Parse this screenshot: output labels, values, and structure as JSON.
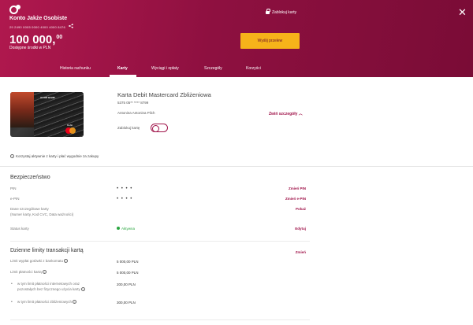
{
  "header": {
    "account_name": "Konto Jakże Osobiste",
    "account_number": "29 2490 0005 0000 4000 4000 8476",
    "balance_main": "100 000,",
    "balance_fraction": "00",
    "balance_label": "Dostępne środki w PLN",
    "block_card": "Zablokuj karty",
    "send_transfer": "Wyślij przelew"
  },
  "tabs": [
    {
      "label": "Historia rachunku"
    },
    {
      "label": "Karty"
    },
    {
      "label": "Wyciągi i opłaty"
    },
    {
      "label": "Szczegóły"
    },
    {
      "label": "Korzyści"
    }
  ],
  "card": {
    "bank_name": "ALIOR BANK",
    "debit_label": "Debit",
    "title": "Karta Debit Mastercard Zbliżeniowa",
    "number": "5375 05** **** 8799",
    "holder": "Antonina Antonina Pilch",
    "collapse_label": "Zwiń szczegóły",
    "block_label": "Zablokuj kartę"
  },
  "promo": "Korzystaj aktywnie z karty i płać wygodnie za zakupy",
  "security": {
    "title": "Bezpieczeństwo",
    "rows": [
      {
        "label": "PIN",
        "value": "• • • •",
        "action": "Zmień PIN"
      },
      {
        "label": "e-PIN",
        "value": "• • • •",
        "action": "Zmień e-PIN"
      },
      {
        "label": "Dane szczegółowe karty",
        "sub": "(Numer karty, Kod CVC, Data ważności)",
        "value": "",
        "action": "Pokaż"
      },
      {
        "label": "Status karty",
        "value": "Aktywna",
        "action": "Edytuj"
      }
    ]
  },
  "limits": {
    "title": "Dzienne limity transakcji kartą",
    "action": "Zmień",
    "rows": [
      {
        "label": "Limit wypłat gotówki z bankomatu",
        "value": "5 000,00 PLN"
      },
      {
        "label": "Limit płatności kartą",
        "value": "5 000,00 PLN"
      },
      {
        "label": "w tym limit płatności internetowych oraz",
        "label2": "pozostałych bez fizycznego użycia karty",
        "value": "200,00 PLN"
      },
      {
        "label": "w tym limit płatności zbliżeniowych",
        "value": "300,00 PLN"
      }
    ]
  },
  "colors": {
    "brand": "#8e1040",
    "accent": "#f6b31a",
    "link": "#a0144a",
    "active": "#2aa640"
  }
}
